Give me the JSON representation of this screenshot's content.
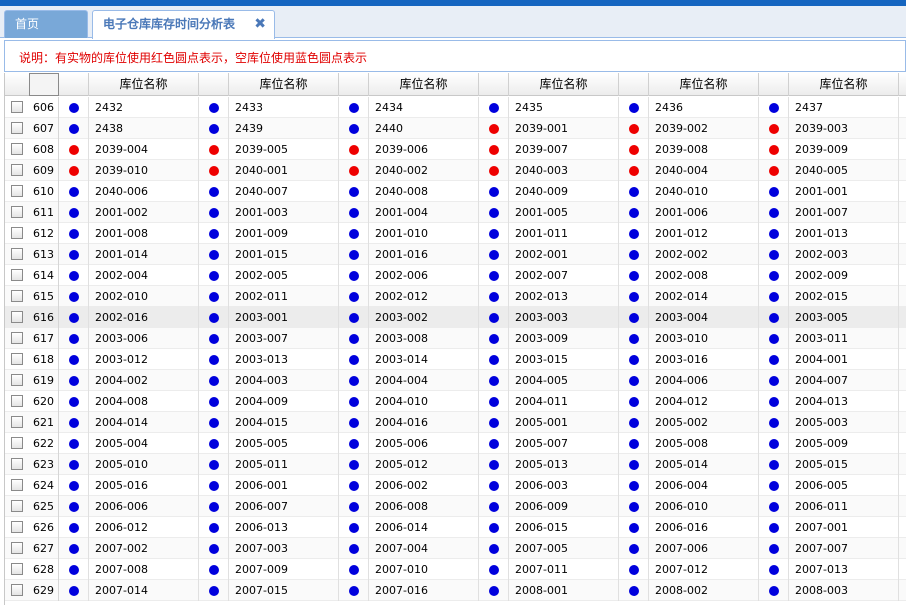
{
  "colors": {
    "occupied": "#ee0000",
    "empty": "#0000dd",
    "note": "#e00000",
    "accent": "#1565c0"
  },
  "tabs": [
    {
      "label": "首页"
    },
    {
      "label": "电子仓库库存时间分析表",
      "close_icon": "✖"
    }
  ],
  "note": "说明：有实物的库位使用红色圆点表示，空库位使用蓝色圆点表示",
  "grid": {
    "column_header": "库位名称",
    "rows": [
      {
        "rn": "606",
        "cells": [
          [
            "2432",
            "b"
          ],
          [
            "2433",
            "b"
          ],
          [
            "2434",
            "b"
          ],
          [
            "2435",
            "b"
          ],
          [
            "2436",
            "b"
          ],
          [
            "2437",
            "b"
          ]
        ]
      },
      {
        "rn": "607",
        "cells": [
          [
            "2438",
            "b"
          ],
          [
            "2439",
            "b"
          ],
          [
            "2440",
            "b"
          ],
          [
            "2039-001",
            "r"
          ],
          [
            "2039-002",
            "r"
          ],
          [
            "2039-003",
            "r"
          ]
        ]
      },
      {
        "rn": "608",
        "cells": [
          [
            "2039-004",
            "r"
          ],
          [
            "2039-005",
            "r"
          ],
          [
            "2039-006",
            "r"
          ],
          [
            "2039-007",
            "r"
          ],
          [
            "2039-008",
            "r"
          ],
          [
            "2039-009",
            "r"
          ]
        ]
      },
      {
        "rn": "609",
        "cells": [
          [
            "2039-010",
            "r"
          ],
          [
            "2040-001",
            "r"
          ],
          [
            "2040-002",
            "r"
          ],
          [
            "2040-003",
            "r"
          ],
          [
            "2040-004",
            "r"
          ],
          [
            "2040-005",
            "r"
          ]
        ]
      },
      {
        "rn": "610",
        "cells": [
          [
            "2040-006",
            "b"
          ],
          [
            "2040-007",
            "b"
          ],
          [
            "2040-008",
            "b"
          ],
          [
            "2040-009",
            "b"
          ],
          [
            "2040-010",
            "b"
          ],
          [
            "2001-001",
            "b"
          ]
        ]
      },
      {
        "rn": "611",
        "cells": [
          [
            "2001-002",
            "b"
          ],
          [
            "2001-003",
            "b"
          ],
          [
            "2001-004",
            "b"
          ],
          [
            "2001-005",
            "b"
          ],
          [
            "2001-006",
            "b"
          ],
          [
            "2001-007",
            "b"
          ]
        ]
      },
      {
        "rn": "612",
        "cells": [
          [
            "2001-008",
            "b"
          ],
          [
            "2001-009",
            "b"
          ],
          [
            "2001-010",
            "b"
          ],
          [
            "2001-011",
            "b"
          ],
          [
            "2001-012",
            "b"
          ],
          [
            "2001-013",
            "b"
          ]
        ]
      },
      {
        "rn": "613",
        "cells": [
          [
            "2001-014",
            "b"
          ],
          [
            "2001-015",
            "b"
          ],
          [
            "2001-016",
            "b"
          ],
          [
            "2002-001",
            "b"
          ],
          [
            "2002-002",
            "b"
          ],
          [
            "2002-003",
            "b"
          ]
        ]
      },
      {
        "rn": "614",
        "cells": [
          [
            "2002-004",
            "b"
          ],
          [
            "2002-005",
            "b"
          ],
          [
            "2002-006",
            "b"
          ],
          [
            "2002-007",
            "b"
          ],
          [
            "2002-008",
            "b"
          ],
          [
            "2002-009",
            "b"
          ]
        ]
      },
      {
        "rn": "615",
        "cells": [
          [
            "2002-010",
            "b"
          ],
          [
            "2002-011",
            "b"
          ],
          [
            "2002-012",
            "b"
          ],
          [
            "2002-013",
            "b"
          ],
          [
            "2002-014",
            "b"
          ],
          [
            "2002-015",
            "b"
          ]
        ]
      },
      {
        "rn": "616",
        "cells": [
          [
            "2002-016",
            "b"
          ],
          [
            "2003-001",
            "b"
          ],
          [
            "2003-002",
            "b"
          ],
          [
            "2003-003",
            "b"
          ],
          [
            "2003-004",
            "b"
          ],
          [
            "2003-005",
            "b"
          ]
        ]
      },
      {
        "rn": "617",
        "cells": [
          [
            "2003-006",
            "b"
          ],
          [
            "2003-007",
            "b"
          ],
          [
            "2003-008",
            "b"
          ],
          [
            "2003-009",
            "b"
          ],
          [
            "2003-010",
            "b"
          ],
          [
            "2003-011",
            "b"
          ]
        ]
      },
      {
        "rn": "618",
        "cells": [
          [
            "2003-012",
            "b"
          ],
          [
            "2003-013",
            "b"
          ],
          [
            "2003-014",
            "b"
          ],
          [
            "2003-015",
            "b"
          ],
          [
            "2003-016",
            "b"
          ],
          [
            "2004-001",
            "b"
          ]
        ]
      },
      {
        "rn": "619",
        "cells": [
          [
            "2004-002",
            "b"
          ],
          [
            "2004-003",
            "b"
          ],
          [
            "2004-004",
            "b"
          ],
          [
            "2004-005",
            "b"
          ],
          [
            "2004-006",
            "b"
          ],
          [
            "2004-007",
            "b"
          ]
        ]
      },
      {
        "rn": "620",
        "cells": [
          [
            "2004-008",
            "b"
          ],
          [
            "2004-009",
            "b"
          ],
          [
            "2004-010",
            "b"
          ],
          [
            "2004-011",
            "b"
          ],
          [
            "2004-012",
            "b"
          ],
          [
            "2004-013",
            "b"
          ]
        ]
      },
      {
        "rn": "621",
        "cells": [
          [
            "2004-014",
            "b"
          ],
          [
            "2004-015",
            "b"
          ],
          [
            "2004-016",
            "b"
          ],
          [
            "2005-001",
            "b"
          ],
          [
            "2005-002",
            "b"
          ],
          [
            "2005-003",
            "b"
          ]
        ]
      },
      {
        "rn": "622",
        "cells": [
          [
            "2005-004",
            "b"
          ],
          [
            "2005-005",
            "b"
          ],
          [
            "2005-006",
            "b"
          ],
          [
            "2005-007",
            "b"
          ],
          [
            "2005-008",
            "b"
          ],
          [
            "2005-009",
            "b"
          ]
        ]
      },
      {
        "rn": "623",
        "cells": [
          [
            "2005-010",
            "b"
          ],
          [
            "2005-011",
            "b"
          ],
          [
            "2005-012",
            "b"
          ],
          [
            "2005-013",
            "b"
          ],
          [
            "2005-014",
            "b"
          ],
          [
            "2005-015",
            "b"
          ]
        ]
      },
      {
        "rn": "624",
        "cells": [
          [
            "2005-016",
            "b"
          ],
          [
            "2006-001",
            "b"
          ],
          [
            "2006-002",
            "b"
          ],
          [
            "2006-003",
            "b"
          ],
          [
            "2006-004",
            "b"
          ],
          [
            "2006-005",
            "b"
          ]
        ]
      },
      {
        "rn": "625",
        "cells": [
          [
            "2006-006",
            "b"
          ],
          [
            "2006-007",
            "b"
          ],
          [
            "2006-008",
            "b"
          ],
          [
            "2006-009",
            "b"
          ],
          [
            "2006-010",
            "b"
          ],
          [
            "2006-011",
            "b"
          ]
        ]
      },
      {
        "rn": "626",
        "cells": [
          [
            "2006-012",
            "b"
          ],
          [
            "2006-013",
            "b"
          ],
          [
            "2006-014",
            "b"
          ],
          [
            "2006-015",
            "b"
          ],
          [
            "2006-016",
            "b"
          ],
          [
            "2007-001",
            "b"
          ]
        ]
      },
      {
        "rn": "627",
        "cells": [
          [
            "2007-002",
            "b"
          ],
          [
            "2007-003",
            "b"
          ],
          [
            "2007-004",
            "b"
          ],
          [
            "2007-005",
            "b"
          ],
          [
            "2007-006",
            "b"
          ],
          [
            "2007-007",
            "b"
          ]
        ]
      },
      {
        "rn": "628",
        "cells": [
          [
            "2007-008",
            "b"
          ],
          [
            "2007-009",
            "b"
          ],
          [
            "2007-010",
            "b"
          ],
          [
            "2007-011",
            "b"
          ],
          [
            "2007-012",
            "b"
          ],
          [
            "2007-013",
            "b"
          ]
        ]
      },
      {
        "rn": "629",
        "cells": [
          [
            "2007-014",
            "b"
          ],
          [
            "2007-015",
            "b"
          ],
          [
            "2007-016",
            "b"
          ],
          [
            "2008-001",
            "b"
          ],
          [
            "2008-002",
            "b"
          ],
          [
            "2008-003",
            "b"
          ]
        ]
      }
    ]
  }
}
